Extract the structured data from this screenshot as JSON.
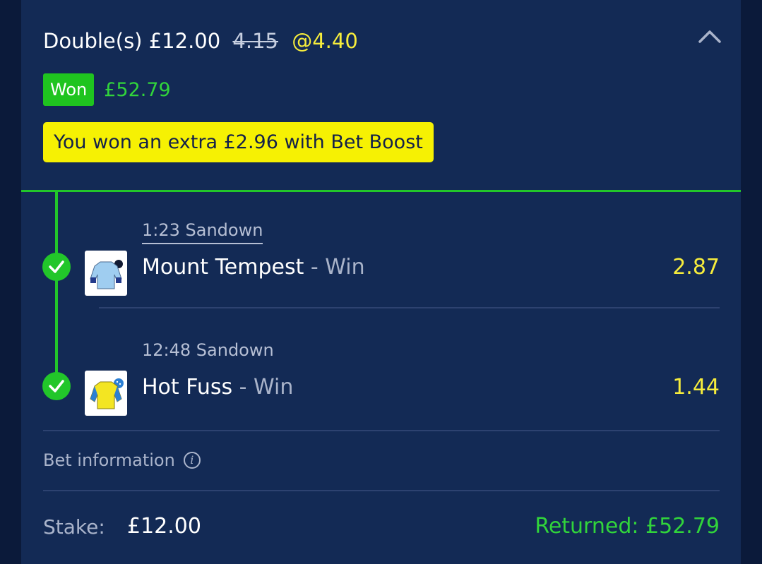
{
  "bet": {
    "type": "Double(s)",
    "stake_amount": "£12.00",
    "original_odds": "4.15",
    "boosted_odds": "@4.40",
    "status": "Won",
    "winnings": "£52.79",
    "boost_message": "You won an extra £2.96 with Bet Boost"
  },
  "selections": [
    {
      "race": "1:23 Sandown",
      "horse": "Mount Tempest",
      "market": "- Win",
      "price": "2.87",
      "result": "won",
      "silk_colors": [
        "#9fcdf0",
        "#233a8a"
      ]
    },
    {
      "race": "12:48 Sandown",
      "horse": "Hot Fuss",
      "market": "- Win",
      "price": "1.44",
      "result": "won",
      "silk_colors": [
        "#f3e522",
        "#2b7fd4"
      ]
    }
  ],
  "footer": {
    "bet_information_label": "Bet information",
    "stake_label": "Stake:",
    "stake_value": "£12.00",
    "returned_label": "Returned: £52.79"
  },
  "icons": {
    "collapse": "chevron-up-icon",
    "check": "check-circle-icon",
    "info": "info-icon",
    "silk": "jockey-silk-icon"
  },
  "colors": {
    "background": "#0b1a3a",
    "card": "#132a55",
    "win_green": "#22c62a",
    "odds_yellow": "#f6ec3c",
    "boost_banner": "#f6f103"
  }
}
